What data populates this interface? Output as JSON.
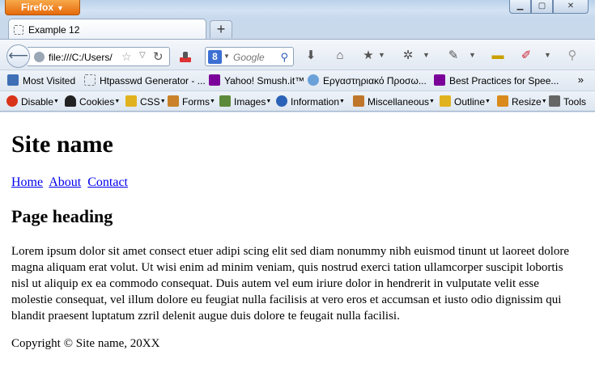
{
  "app": {
    "firefox_button": "Firefox"
  },
  "tabs": [
    {
      "title": "Example 12"
    }
  ],
  "navbar": {
    "url": "file:///C:/Users/",
    "search_placeholder": "Google"
  },
  "bookmarks": [
    {
      "label": "Most Visited",
      "icon": "most-visited-icon",
      "color": "#3f6fb5"
    },
    {
      "label": "Htpasswd Generator - ...",
      "icon": "page-icon",
      "color": "#ffffff"
    },
    {
      "label": "Yahoo! Smush.it™",
      "icon": "yahoo-icon",
      "color": "#7b0099"
    },
    {
      "label": "Εργαστηριακό Προσω...",
      "icon": "chat-icon",
      "color": "#6ba0d8"
    },
    {
      "label": "Best Practices for Spee...",
      "icon": "yahoo-icon",
      "color": "#7b0099"
    }
  ],
  "devbar": [
    {
      "label": "Disable",
      "icon": "disable-icon",
      "color": "#d9331a"
    },
    {
      "label": "Cookies",
      "icon": "cookie-user-icon",
      "color": "#222222"
    },
    {
      "label": "CSS",
      "icon": "pencil-icon",
      "color": "#e1b21f"
    },
    {
      "label": "Forms",
      "icon": "clipboard-icon",
      "color": "#c9822a"
    },
    {
      "label": "Images",
      "icon": "image-icon",
      "color": "#5d8a3a"
    },
    {
      "label": "Information",
      "icon": "info-icon",
      "color": "#2a62b8"
    },
    {
      "label": "Miscellaneous",
      "icon": "book-icon",
      "color": "#c0762a"
    },
    {
      "label": "Outline",
      "icon": "pencil-icon",
      "color": "#e1b21f"
    },
    {
      "label": "Resize",
      "icon": "pencil-icon",
      "color": "#d98a1a"
    },
    {
      "label": "Tools",
      "icon": "tools-icon",
      "color": "#666666"
    }
  ],
  "page": {
    "site_name": "Site name",
    "nav": [
      "Home",
      "About",
      "Contact"
    ],
    "heading": "Page heading",
    "body": "Lorem ipsum dolor sit amet consect etuer adipi scing elit sed diam nonummy nibh euismod tinunt ut laoreet dolore magna aliquam erat volut. Ut wisi enim ad minim veniam, quis nostrud exerci tation ullamcorper suscipit lobortis nisl ut aliquip ex ea commodo consequat. Duis autem vel eum iriure dolor in hendrerit in vulputate velit esse molestie consequat, vel illum dolore eu feugiat nulla facilisis at vero eros et accumsan et iusto odio dignissim qui blandit praesent luptatum zzril delenit augue duis dolore te feugait nulla facilisi.",
    "copyright": "Copyright © Site name, 20XX"
  }
}
